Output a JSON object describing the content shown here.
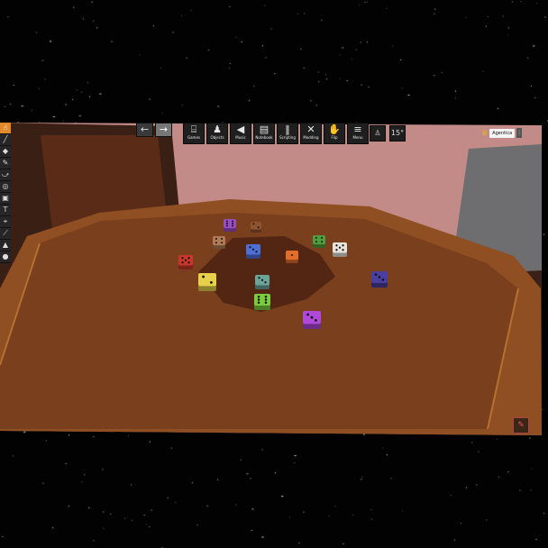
{
  "toolbar": {
    "nav": {
      "back_label": "←",
      "forward_label": "→"
    },
    "tools": [
      {
        "id": "games",
        "label": "Games",
        "icon": "games-icon",
        "glyph": "⌸"
      },
      {
        "id": "objects",
        "label": "Objects",
        "icon": "pawn-icon",
        "glyph": "♟"
      },
      {
        "id": "music",
        "label": "Music",
        "icon": "speaker-icon",
        "glyph": "◀"
      },
      {
        "id": "notebook",
        "label": "Notebook",
        "icon": "notebook-icon",
        "glyph": "▤"
      },
      {
        "id": "modding",
        "label": "Modding",
        "icon": "tools-icon",
        "glyph": "✕"
      },
      {
        "id": "flip",
        "label": "Flip",
        "icon": "flip-icon",
        "glyph": "✋"
      },
      {
        "id": "menu",
        "label": "Menu",
        "icon": "hamburger-icon",
        "glyph": "≡"
      }
    ],
    "hidden_tool_label": "Scripting",
    "rotation_value": "15°",
    "figure_glyph": "♙",
    "player_name": "Agentica",
    "player_menu_glyph": "⋮"
  },
  "left_tools": [
    {
      "icon": "grab-cursor-icon",
      "glyph": "☝",
      "active": true
    },
    {
      "icon": "line-tool-icon",
      "glyph": "╱",
      "active": false
    },
    {
      "icon": "flick-tool-icon",
      "glyph": "◆",
      "active": false
    },
    {
      "icon": "pen-tool-icon",
      "glyph": "✎",
      "active": false
    },
    {
      "icon": "joint-tool-icon",
      "glyph": "⤻",
      "active": false
    },
    {
      "icon": "snap-tool-icon",
      "glyph": "◎",
      "active": false
    },
    {
      "icon": "zone-tool-icon",
      "glyph": "▣",
      "active": false
    },
    {
      "icon": "text-tool-icon",
      "glyph": "T",
      "active": false
    },
    {
      "icon": "gizmo-tool-icon",
      "glyph": "⌖",
      "active": false
    },
    {
      "icon": "vector-tool-icon",
      "glyph": "⟋",
      "active": false
    },
    {
      "icon": "color-tool-icon",
      "glyph": "▲",
      "active": false
    },
    {
      "icon": "color-swatch-icon",
      "glyph": "●",
      "active": false
    }
  ],
  "pencil_glyph": "✎",
  "colors": {
    "wall": "#c99090",
    "felt": "#7a3f1c",
    "rim": "#8c4d22",
    "shadow": "#4e2413"
  },
  "dice": [
    {
      "color": "Purple",
      "face": 6,
      "hex": "#9b4ec2"
    },
    {
      "color": "Brown",
      "face": 2,
      "hex": "#8e5430"
    },
    {
      "color": "Tan",
      "face": 4,
      "hex": "#b07b54"
    },
    {
      "color": "Blue",
      "face": 3,
      "hex": "#4e6fd6"
    },
    {
      "color": "Orange",
      "face": 1,
      "hex": "#e36e2a"
    },
    {
      "color": "Green",
      "face": 4,
      "hex": "#4f9d3d"
    },
    {
      "color": "White",
      "face": 5,
      "hex": "#e8e4dc"
    },
    {
      "color": "Red",
      "face": 5,
      "hex": "#c8372a"
    },
    {
      "color": "Yellow",
      "face": 2,
      "hex": "#e7d04a"
    },
    {
      "color": "Teal",
      "face": 3,
      "hex": "#6aa59a"
    },
    {
      "color": "Lime",
      "face": 6,
      "hex": "#7ccd3e"
    },
    {
      "color": "Indigo",
      "face": 3,
      "hex": "#4a3e9e"
    },
    {
      "color": "Magenta",
      "face": 3,
      "hex": "#b048d9"
    }
  ]
}
